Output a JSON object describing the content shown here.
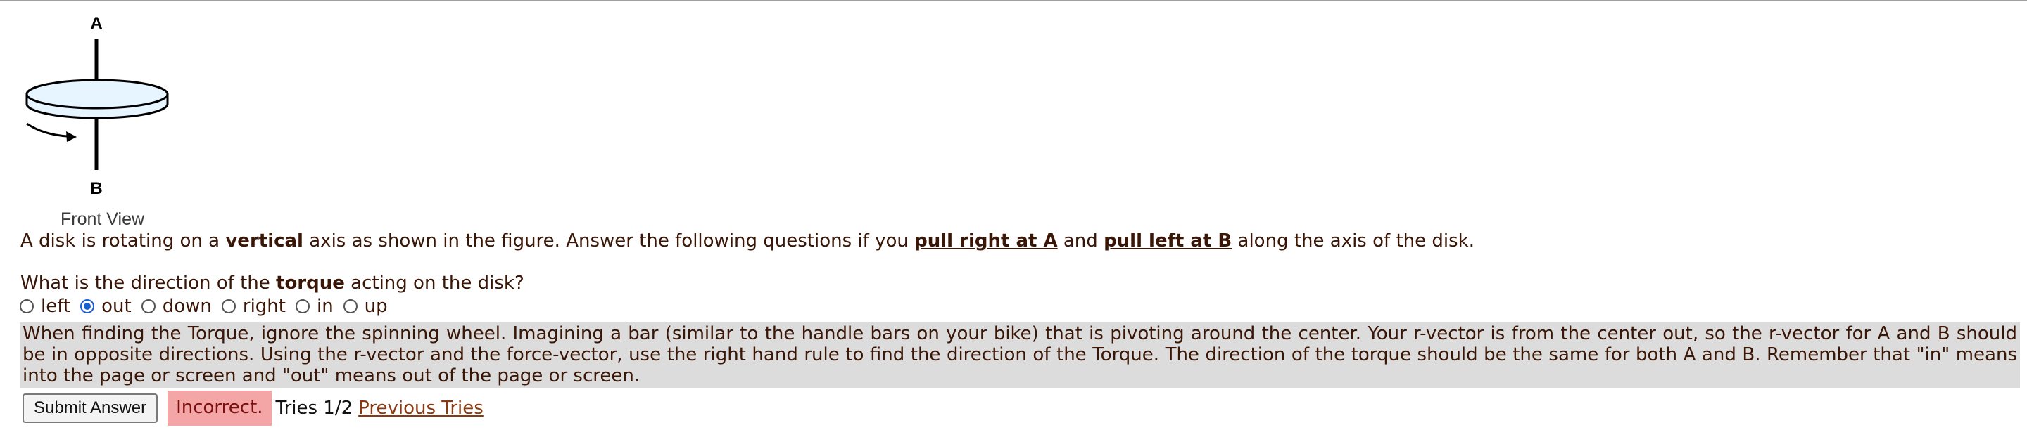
{
  "figure": {
    "label_top": "A",
    "label_bottom": "B",
    "caption": "Front View"
  },
  "statement": {
    "part1": "A disk is rotating on a ",
    "vertical": "vertical",
    "part2": " axis as shown in the figure. Answer the following questions if you ",
    "link1": "pull right at A",
    "part3": " and ",
    "link2": "pull left at B",
    "part4": " along the axis of the disk."
  },
  "question": {
    "part1": "What is the direction of the ",
    "bold": "torque",
    "part2": " acting on the disk?"
  },
  "options": [
    {
      "label": "left",
      "checked": false
    },
    {
      "label": "out",
      "checked": true
    },
    {
      "label": "down",
      "checked": false
    },
    {
      "label": "right",
      "checked": false
    },
    {
      "label": "in",
      "checked": false
    },
    {
      "label": "up",
      "checked": false
    }
  ],
  "hint": "When finding the Torque, ignore the spinning wheel. Imagining a bar (similar to the handle bars on your bike) that is pivoting around the center. Your r-vector is from the center out, so the r-vector for A and B should be in opposite directions. Using the r-vector and the force-vector, use the right hand rule to find the direction of the Torque. The direction of the torque should be the same for both A and B. Remember that \"in\" means into the page or screen and \"out\" means out of the page or screen.",
  "actions": {
    "submit_label": "Submit Answer",
    "result": "Incorrect.",
    "tries": "Tries 1/2",
    "previous": "Previous Tries"
  }
}
